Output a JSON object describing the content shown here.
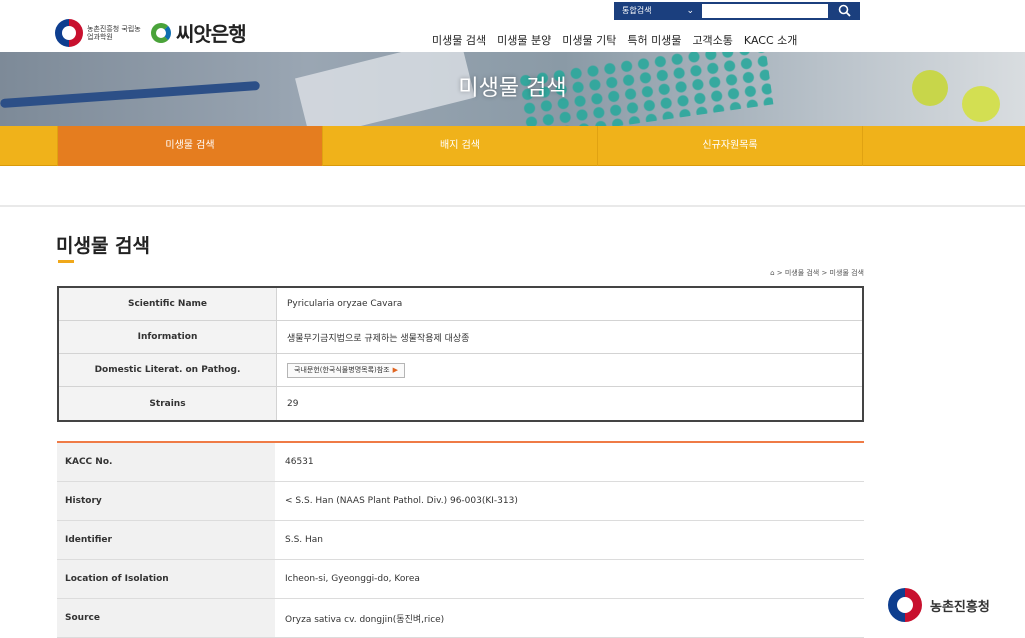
{
  "header": {
    "agency_small_name": "농촌진흥청 국립농업과학원",
    "brand_name": "씨앗은행",
    "search": {
      "scope": "통합검색",
      "placeholder": ""
    },
    "gnb": [
      {
        "label": "미생물 검색"
      },
      {
        "label": "미생물 분양"
      },
      {
        "label": "미생물 기탁"
      },
      {
        "label": "특허 미생물"
      },
      {
        "label": "고객소통"
      },
      {
        "label": "KACC 소개"
      }
    ]
  },
  "banner": {
    "title": "미생물 검색"
  },
  "subnav": {
    "tabs": [
      {
        "label": "미생물 검색",
        "active": true
      },
      {
        "label": "배지 검색",
        "active": false
      },
      {
        "label": "신규자원목록",
        "active": false
      }
    ]
  },
  "content": {
    "page_title": "미생물 검색",
    "breadcrumb": "⌂ > 미생물 검색 > 미생물 검색",
    "info_rows": [
      {
        "label": "Scientific Name",
        "value": "Pyricularia oryzae   Cavara"
      },
      {
        "label": "Information",
        "value": "생물무기금지법으로 규제하는 생물작용제 대상종"
      },
      {
        "label": "Domestic Literat. on Pathog.",
        "button": "국내문헌(한국식물병명목록)참조"
      },
      {
        "label": "Strains",
        "value": "29"
      }
    ],
    "strain_rows": [
      {
        "label": "KACC No.",
        "value": "46531"
      },
      {
        "label": "History",
        "value": "< S.S. Han (NAAS Plant Pathol. Div.) 96-003(KI-313)"
      },
      {
        "label": "Identifier",
        "value": "S.S. Han"
      },
      {
        "label": "Location of Isolation",
        "value": "Icheon-si, Gyeonggi-do, Korea"
      },
      {
        "label": "Source",
        "value": "Oryza sativa cv. dongjin(동진벼,rice)"
      }
    ]
  },
  "footer_logo": {
    "name": "농촌진흥청"
  },
  "colors": {
    "tab_bar": "#f0b21a",
    "tab_active": "#e57d1f",
    "search_navy": "#1b3f7e",
    "accent_orange": "#ef7b46"
  }
}
